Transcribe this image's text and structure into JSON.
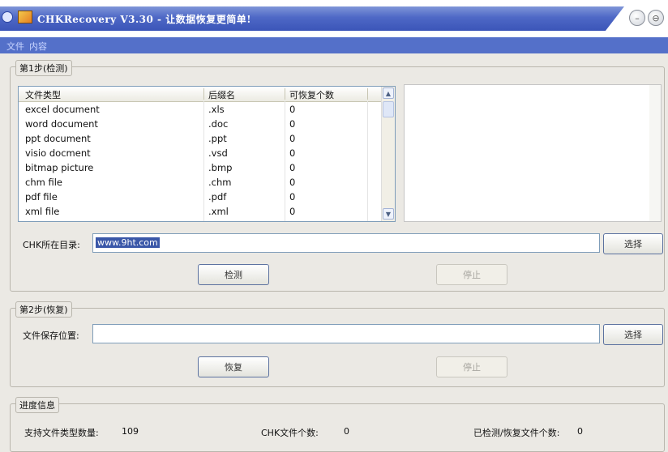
{
  "window": {
    "title": "CHKRecovery V3.30 - 让数据恢复更简单!",
    "minimize_glyph": "–",
    "close_glyph": "⊖"
  },
  "menu": {
    "items": [
      "文件",
      "内容"
    ]
  },
  "step1": {
    "legend": "第1步(检测)",
    "table": {
      "headers": [
        "文件类型",
        "后缀名",
        "可恢复个数"
      ],
      "rows": [
        [
          "excel document",
          ".xls",
          "0"
        ],
        [
          "word document",
          ".doc",
          "0"
        ],
        [
          "ppt document",
          ".ppt",
          "0"
        ],
        [
          "visio docment",
          ".vsd",
          "0"
        ],
        [
          "bitmap picture",
          ".bmp",
          "0"
        ],
        [
          "chm file",
          ".chm",
          "0"
        ],
        [
          "pdf file",
          ".pdf",
          "0"
        ],
        [
          "xml file",
          ".xml",
          "0"
        ]
      ]
    },
    "dir_label": "CHK所在目录:",
    "dir_value": "www.9ht.com",
    "browse_label": "选择",
    "detect_label": "检测",
    "stop_label": "停止"
  },
  "step2": {
    "legend": "第2步(恢复)",
    "save_label": "文件保存位置:",
    "save_value": "",
    "browse_label": "选择",
    "recover_label": "恢复",
    "stop_label": "停止"
  },
  "progress": {
    "legend": "进度信息",
    "supported_label": "支持文件类型数量:",
    "supported_value": "109",
    "chk_label": "CHK文件个数:",
    "chk_value": "0",
    "done_label": "已检测/恢复文件个数:",
    "done_value": "0"
  },
  "icons": {
    "scroll_up": "▲",
    "scroll_down": "▼"
  },
  "colors": {
    "title_bar": "#4e68c6",
    "menu_bar": "#5470c9",
    "selection": "#3a57a8"
  }
}
